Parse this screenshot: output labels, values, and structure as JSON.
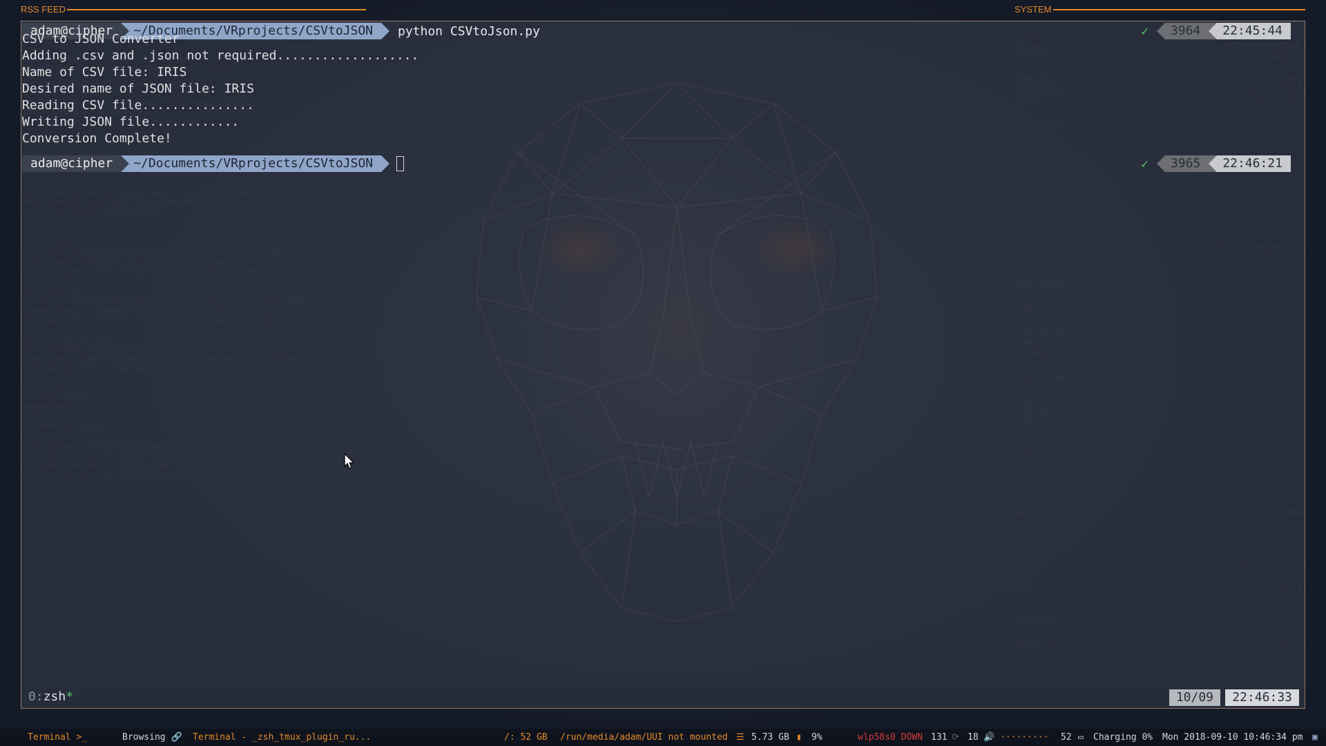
{
  "headers": {
    "rss_feed": "RSS FEED",
    "system": "SYSTEM"
  },
  "rss_widget": {
    "lines": [
      "Whelan Hinton Heat This Is A'¢On Politics A'¢",
      "Shadow Sanctions the Officials Over Muslim Detention Ca",
      "Sackshow Pleads Guilty as Criminal Court, PLO",
      "US Settles with to end agreement on child migrant detention",
      "Israel's Netanyahu regime kept in jail",
      "Jarosław Kaczyński's Polish Populist Contrast",
      "Nikkei's Bad Air",
      "Trump, Spinoza and the Palestinian Refugees",
      "Guido Fawkes",
      "Current No. 10 Aide Co-Authored Boris A'¢Dodgy DossierA'¢",
      "Help Crowd-Source MPsA'¢ Brexit Voting Intentions",
      "CorbynA'¢s Constituency Abolished",
      "TECHNOLOGY",
      "TechCrunch",
      "Can QualcommA'¢s new Snapdragon Wear chip breathe life into Wear OS?",
      "Not hog dog? PixFood lets you shoot and identify food",
      "Hoodline raises $10M for its hyper-local, automated data newswire",
      "The Next Web",
      "Upcoming Android watches will get a big battery boost thanks to new Qual",
      "Cryptocurrency is actually terrible for battling inflation, data shows",
      "The crypto-jacking epidemic continues, 280K infected routers detected by",
      "WIRED Feed: All Latest",
      "Star Wars News: 'Episode IX' Just Recruited a Doctor",
      "Emmy Endorsement: In Praise of 'Barbershop,' the Other Genius 'Atlanta'",
      "HP's New 3-D Printers Build Items Not of Plastic but of Steel",
      "PHYSICS",
      "Not Even Wrong",
      "Beyond Weird",
      "Quick Links",
      "Quantum Supremacy",
      "APS Physics - spotlighting exceptional research",
      "Focus: More Energy from Ocean Waves",
      "Synopsis: Detection of a Zigzag Wigner Crystal",
      "Synopsis: Fish Eye Lens Could Entangle Atoms"
    ]
  },
  "system_widget": {
    "lines": [
      "DISTRO:",
      "KERNEL:",
      "UPTIME:",
      "THROTTLE:",
      "PROCESSES:",
      "LOAD:",
      "HARDWARE",
      "CPU1",
      "CPU2",
      "CPU3",
      "CPU4",
      "RAM",
      "PROCESSES",
      "HIGHEST CPU",
      "CHROMIUM",
      "CHROMIUM",
      "PULSEAUDIO",
      "HIGHEST MEM",
      "CHROMIUM",
      "CHROMIUM",
      "CHROMIUM",
      "FILESYSTEM",
      "READ:",
      "WRITE:",
      "ROOT:",
      "USB:",
      "NETWORK",
      "DOWN 0B",
      "TOTAL 0B"
    ],
    "values": [
      "4.17.19-1-MANJARO",
      "0H 14M 10S",
      "729 MHZ",
      "179 (2 RUNNING)",
      "0.49 1.18 1.17",
      "1.68GiB / 7.68GiB (21%)",
      "50.1GiB / 108GiB",
      "0B / 0B",
      "UP 0B",
      "20.0KiB"
    ]
  },
  "terminal": {
    "prompt1": {
      "user": "adam@cipher",
      "path": "~/Documents/VRprojects/CSVtoJSON",
      "command": "python CSVtoJson.py",
      "status_check": "✓",
      "history_number": "3964",
      "time": "22:45:44"
    },
    "output": [
      "CSV to JSON Converter",
      "Adding .csv and .json not required...................",
      "Name of CSV file: IRIS",
      "Desired name of JSON file: IRIS",
      "Reading CSV file...............",
      "Writing JSON file............",
      "Conversion Complete!"
    ],
    "prompt2": {
      "user": "adam@cipher",
      "path": "~/Documents/VRprojects/CSVtoJSON",
      "status_check": "✓",
      "history_number": "3965",
      "time": "22:46:21"
    }
  },
  "tmux": {
    "window_index": "0:",
    "window_name": "zsh",
    "window_flag": "*",
    "date": "10/09",
    "time": "22:46:33"
  },
  "bottom_bar": {
    "workspace_terminal": "Terminal",
    "workspace_terminal_icon": ">_",
    "workspace_browsing": "Browsing",
    "link_icon": "link-icon",
    "active_window_title": "Terminal - _zsh_tmux_plugin_ru...",
    "root_disk": "/: 52 GB",
    "media_mount": "/run/media/adam/UUI not mounted",
    "memory": "5.73 GB",
    "cpu": "9%",
    "network": "wlp58s0 DOWN",
    "packages": "131",
    "updates": "18",
    "volume_dots": "·········",
    "volume": "52",
    "battery": "Charging 0%",
    "datetime": "Mon 2018-09-10 10:46:34 pm"
  },
  "colors": {
    "accent_orange": "#e58a2a",
    "path_blue": "#8fa6c9",
    "ok_green": "#59c46a",
    "alert_red": "#d23a3a"
  }
}
